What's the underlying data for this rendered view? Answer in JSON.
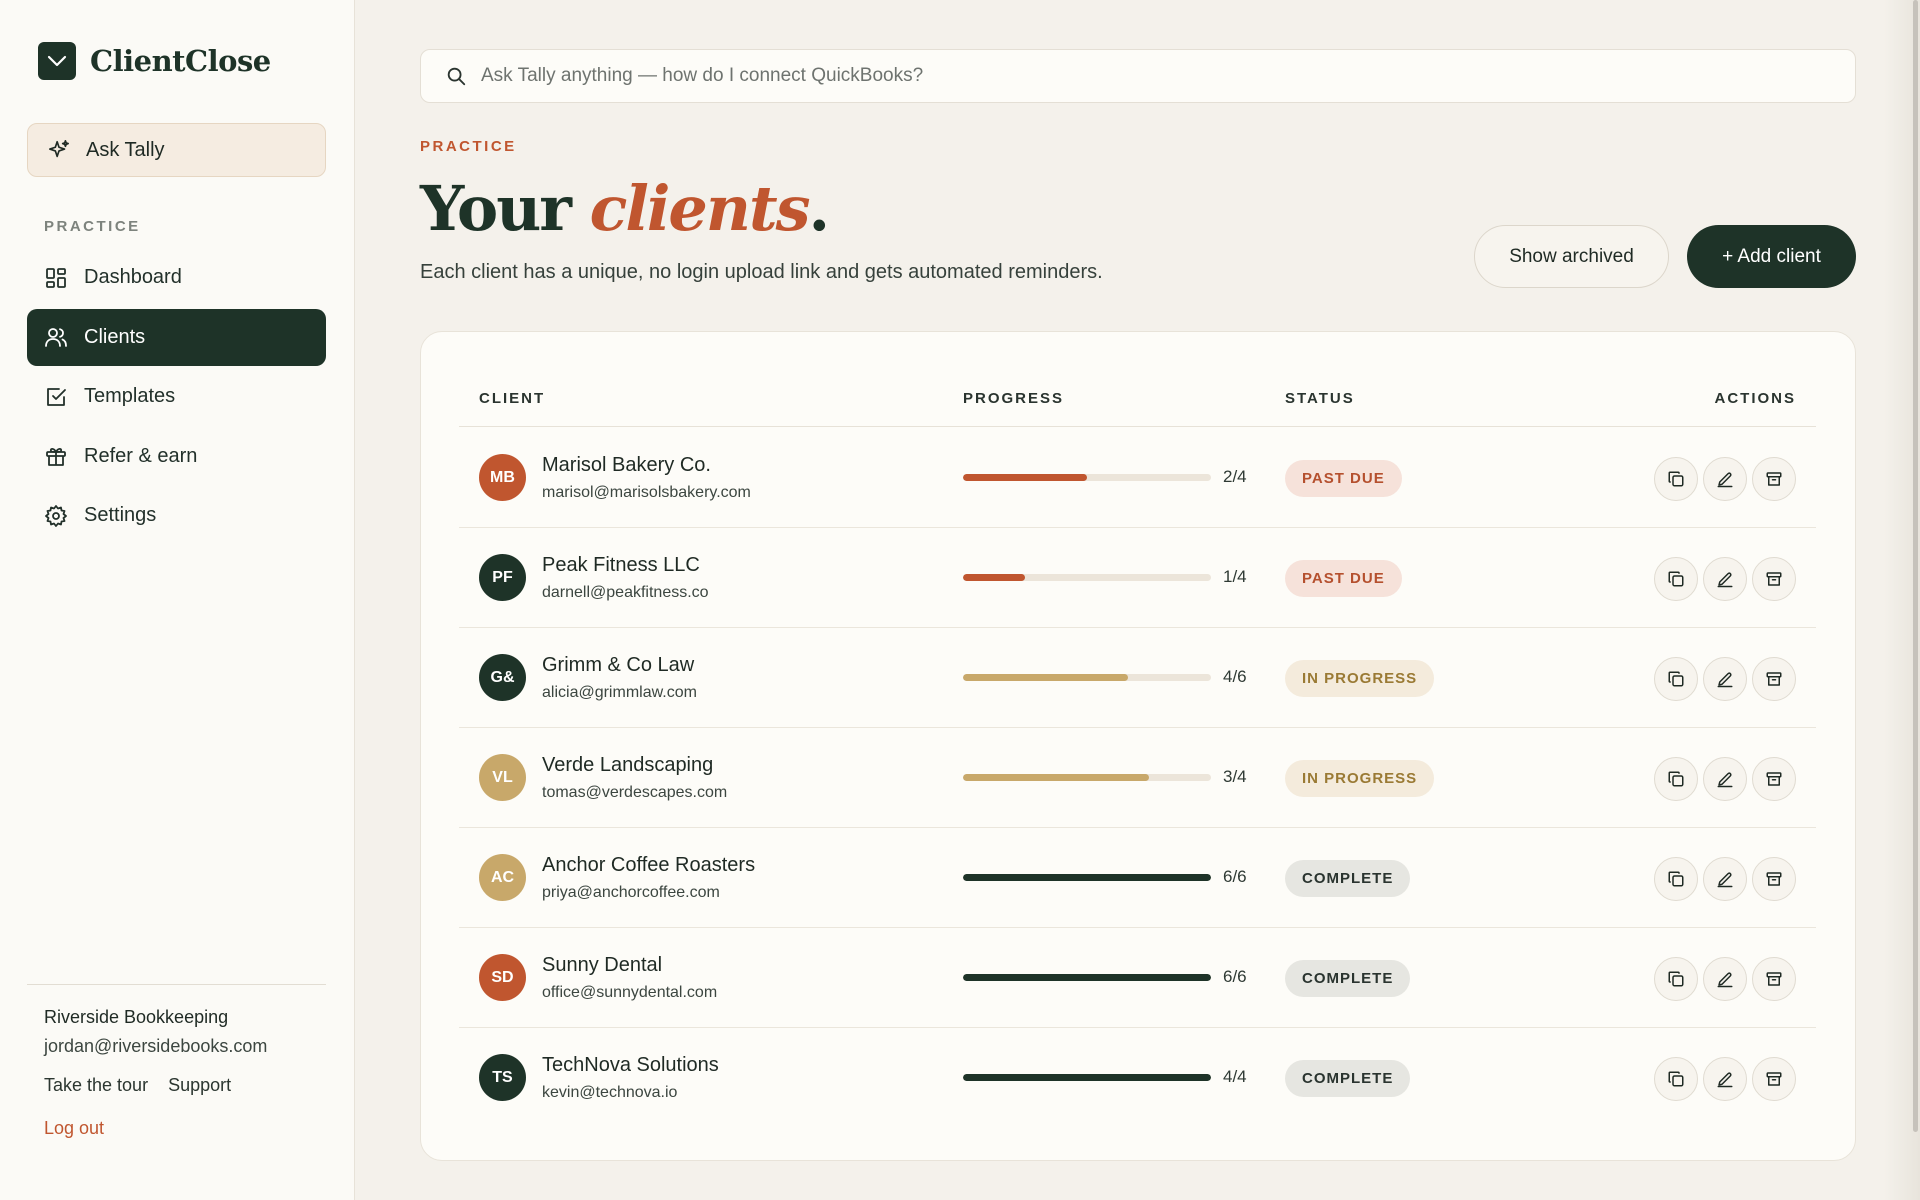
{
  "brand": {
    "name": "ClientClose"
  },
  "sidebar": {
    "ask_label": "Ask Tally",
    "section_label": "PRACTICE",
    "items": [
      {
        "label": "Dashboard",
        "icon": "dashboard-icon"
      },
      {
        "label": "Clients",
        "icon": "users-icon",
        "active": true
      },
      {
        "label": "Templates",
        "icon": "checkbox-icon"
      },
      {
        "label": "Refer & earn",
        "icon": "gift-icon"
      },
      {
        "label": "Settings",
        "icon": "gear-icon"
      }
    ],
    "footer": {
      "org_name": "Riverside Bookkeeping",
      "org_email": "jordan@riversidebooks.com",
      "tour_label": "Take the tour",
      "support_label": "Support",
      "logout_label": "Log out"
    }
  },
  "search": {
    "placeholder": "Ask Tally anything — how do I connect QuickBooks?"
  },
  "header": {
    "eyebrow": "PRACTICE",
    "title_plain": "Your ",
    "title_accent": "clients",
    "title_end": ".",
    "subtitle": "Each client has a unique, no login upload link and gets automated reminders.",
    "show_archived_label": "Show archived",
    "add_client_label": "+ Add client"
  },
  "table": {
    "columns": {
      "client": "CLIENT",
      "progress": "PROGRESS",
      "status": "STATUS",
      "actions": "ACTIONS"
    },
    "rows": [
      {
        "initials": "MB",
        "avatar_color": "#c0562f",
        "name": "Marisol Bakery Co.",
        "email": "marisol@marisolsbakery.com",
        "done": 2,
        "total": 4,
        "progress_label": "2/4",
        "status": "PAST DUE",
        "status_kind": "past"
      },
      {
        "initials": "PF",
        "avatar_color": "#1e3328",
        "name": "Peak Fitness LLC",
        "email": "darnell@peakfitness.co",
        "done": 1,
        "total": 4,
        "progress_label": "1/4",
        "status": "PAST DUE",
        "status_kind": "past"
      },
      {
        "initials": "G&",
        "avatar_color": "#1e3328",
        "name": "Grimm & Co Law",
        "email": "alicia@grimmlaw.com",
        "done": 4,
        "total": 6,
        "progress_label": "4/6",
        "status": "IN PROGRESS",
        "status_kind": "prog"
      },
      {
        "initials": "VL",
        "avatar_color": "#c8a86a",
        "name": "Verde Landscaping",
        "email": "tomas@verdescapes.com",
        "done": 3,
        "total": 4,
        "progress_label": "3/4",
        "status": "IN PROGRESS",
        "status_kind": "prog"
      },
      {
        "initials": "AC",
        "avatar_color": "#c8a86a",
        "name": "Anchor Coffee Roasters",
        "email": "priya@anchorcoffee.com",
        "done": 6,
        "total": 6,
        "progress_label": "6/6",
        "status": "COMPLETE",
        "status_kind": "done"
      },
      {
        "initials": "SD",
        "avatar_color": "#c0562f",
        "name": "Sunny Dental",
        "email": "office@sunnydental.com",
        "done": 6,
        "total": 6,
        "progress_label": "6/6",
        "status": "COMPLETE",
        "status_kind": "done"
      },
      {
        "initials": "TS",
        "avatar_color": "#1e3328",
        "name": "TechNova Solutions",
        "email": "kevin@technova.io",
        "done": 4,
        "total": 4,
        "progress_label": "4/4",
        "status": "COMPLETE",
        "status_kind": "done"
      }
    ],
    "action_icons": [
      "copy-icon",
      "edit-icon",
      "archive-icon"
    ]
  },
  "colors": {
    "brand_dark": "#1e3328",
    "accent": "#c0562f",
    "progress_past": "#c0562f",
    "progress_in": "#c8a86a",
    "progress_done": "#1e3328"
  }
}
